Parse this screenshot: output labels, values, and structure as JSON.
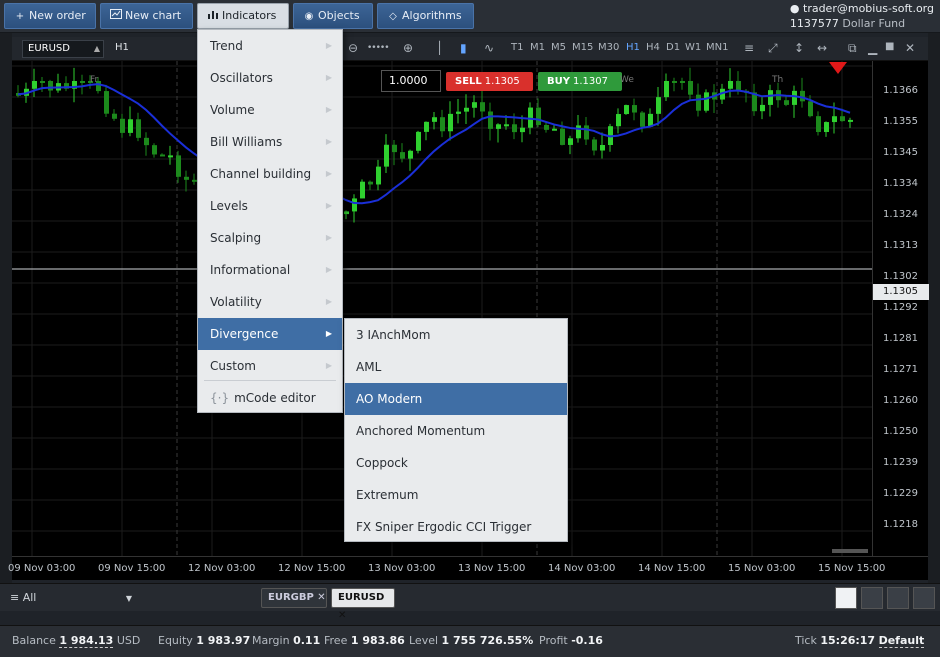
{
  "toolbar": {
    "new_order": "New order",
    "new_chart": "New chart",
    "indicators": "Indicators",
    "objects": "Objects",
    "algorithms": "Algorithms"
  },
  "account": {
    "user": "trader@mobius-soft.org",
    "number": "1137577",
    "fund": "Dollar Fund"
  },
  "chart": {
    "symbol": "EURUSD",
    "timeframe": "H1",
    "timeframes": [
      "T1",
      "M1",
      "M5",
      "M15",
      "M30",
      "H1",
      "H4",
      "D1",
      "W1",
      "MN1"
    ],
    "selected_timeframe": "H1",
    "quantity": "1.0000",
    "sell_label": "SELL",
    "sell_price": "1.1305",
    "buy_label": "BUY",
    "buy_price": "1.1307",
    "current_price": "1.1305",
    "day_labels": [
      "Fr",
      "We",
      "Th"
    ],
    "price_labels": [
      "1.1366",
      "1.1355",
      "1.1345",
      "1.1334",
      "1.1324",
      "1.1313",
      "1.1302",
      "1.1292",
      "1.1281",
      "1.1271",
      "1.1260",
      "1.1250",
      "1.1239",
      "1.1229",
      "1.1218"
    ],
    "time_labels": [
      "09 Nov 03:00",
      "09 Nov 15:00",
      "12 Nov 03:00",
      "12 Nov 15:00",
      "13 Nov 03:00",
      "13 Nov 15:00",
      "14 Nov 03:00",
      "14 Nov 15:00",
      "15 Nov 03:00",
      "15 Nov 15:00"
    ],
    "colors": {
      "bull": "#2fd02f",
      "bear": "#1c8a1c",
      "ma": "#1a2fd8",
      "sell": "#d9302c",
      "buy": "#2f9a3b"
    }
  },
  "indicators_menu": {
    "items": [
      "Trend",
      "Oscillators",
      "Volume",
      "Bill Williams",
      "Channel building",
      "Levels",
      "Scalping",
      "Informational",
      "Volatility",
      "Divergence",
      "Custom"
    ],
    "selected": "Divergence",
    "editor": "mCode editor"
  },
  "divergence_submenu": {
    "items": [
      "3 IAnchMom",
      "AML",
      "AO Modern",
      "Anchored Momentum",
      "Coppock",
      "Extremum",
      "FX Sniper Ergodic CCI Trigger"
    ],
    "selected": "AO Modern"
  },
  "bottom_panel": {
    "filter": "All",
    "tabs": [
      "EURGBP",
      "EURUSD"
    ],
    "active_tab": "EURUSD"
  },
  "status": {
    "balance_label": "Balance",
    "balance": "1 984.13",
    "balance_currency": "USD",
    "equity_label": "Equity",
    "equity": "1 983.97",
    "margin_label": "Margin",
    "margin": "0.11",
    "free_label": "Free",
    "free": "1 983.86",
    "level_label": "Level",
    "level": "1 755 726.55%",
    "profit_label": "Profit",
    "profit": "-0.16",
    "tick_label": "Tick",
    "tick": "15:26:17",
    "tick_mode": "Default"
  }
}
